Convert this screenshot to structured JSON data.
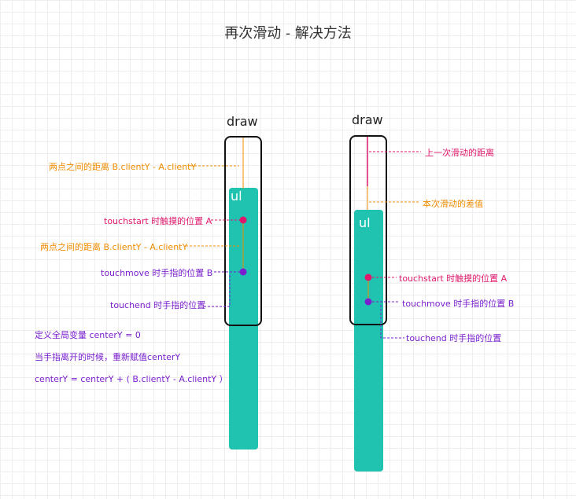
{
  "title": "再次滑动 - 解决方法",
  "left": {
    "draw_label": "draw",
    "ul_label": "ul",
    "distance_label_1": "两点之间的距离 B.clientY - A.clientY",
    "touchstart_label": "touchstart 时触摸的位置 A",
    "distance_label_2": "两点之间的距离 B.clientY - A.clientY",
    "touchmove_label": "touchmove 时手指的位置 B",
    "touchend_label": "touchend 时手指的位置",
    "note_1": "定义全局变量 centerY = 0",
    "note_2": "当手指离开的时候，重新赋值centerY",
    "note_3": "centerY = centerY + ( B.clientY - A.clientY ）"
  },
  "right": {
    "draw_label": "draw",
    "ul_label": "ul",
    "last_distance_label": "上一次滑动的距离",
    "diff_label": "本次滑动的差值",
    "touchstart_label": "touchstart 时触摸的位置 A",
    "touchmove_label": "touchmove 时手指的位置 B",
    "touchend_label": "touchend 时手指的位置"
  },
  "colors": {
    "teal": "#1fc3b0",
    "orange": "#f08c00",
    "pink": "#e0186b",
    "purple": "#7a1fcf",
    "frame": "#111111"
  }
}
